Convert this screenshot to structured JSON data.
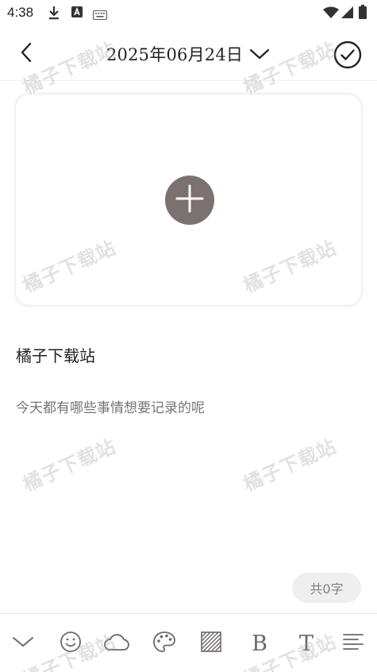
{
  "status_bar": {
    "time": "4:38",
    "left_icons": [
      "download-icon",
      "font-a-icon",
      "keyboard-icon"
    ],
    "right_icons": [
      "wifi-icon",
      "cellular-signal-icon",
      "battery-icon"
    ]
  },
  "header": {
    "back_icon": "chevron-left-icon",
    "date": "2025年06月24日",
    "date_dropdown_icon": "chevron-down-icon",
    "confirm_icon": "check-circle-icon"
  },
  "image_card": {
    "add_icon": "plus-icon",
    "add_button_color": "#7b716f"
  },
  "note": {
    "title": "橘子下载站",
    "body_placeholder": "今天都有哪些事情想要记录的呢",
    "body_value": ""
  },
  "word_count": "共0字",
  "toolbar": {
    "items": [
      {
        "name": "collapse",
        "icon": "chevron-down-icon"
      },
      {
        "name": "emoji",
        "icon": "smiley-icon"
      },
      {
        "name": "weather",
        "icon": "cloud-icon"
      },
      {
        "name": "theme",
        "icon": "palette-icon"
      },
      {
        "name": "background",
        "icon": "stripes-icon"
      },
      {
        "name": "bold",
        "label": "B"
      },
      {
        "name": "font-size",
        "label": "T"
      },
      {
        "name": "align",
        "icon": "align-lines-icon"
      }
    ]
  },
  "watermark": "橘子下载站",
  "colors": {
    "accent": "#7b716f",
    "text": "#222222",
    "placeholder": "#8b8787"
  }
}
